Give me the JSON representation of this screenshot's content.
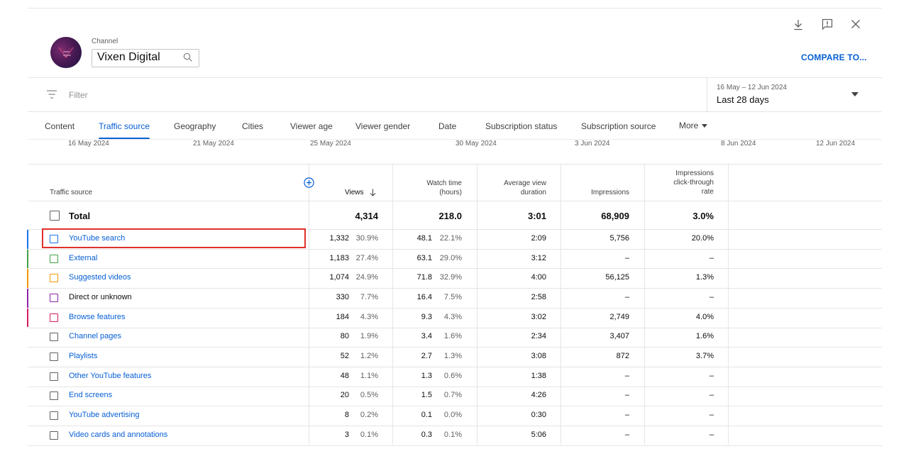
{
  "header": {
    "channel_label": "Channel",
    "channel_name": "Vixen Digital",
    "avatar_text": "vixen digital",
    "compare_label": "COMPARE TO...",
    "icons": [
      "download-icon",
      "feedback-icon",
      "close-icon",
      "search-icon"
    ]
  },
  "filter": {
    "placeholder": "Filter",
    "date_range": "16 May – 12 Jun 2024",
    "period": "Last 28 days"
  },
  "tabs": [
    {
      "label": "Content"
    },
    {
      "label": "Traffic source",
      "active": true
    },
    {
      "label": "Geography"
    },
    {
      "label": "Cities"
    },
    {
      "label": "Viewer age"
    },
    {
      "label": "Viewer gender"
    },
    {
      "label": "Date"
    },
    {
      "label": "Subscription status"
    },
    {
      "label": "Subscription source"
    },
    {
      "label": "More"
    }
  ],
  "date_ticks": [
    "16 May 2024",
    "21 May 2024",
    "25 May 2024",
    "30 May 2024",
    "3 Jun 2024",
    "8 Jun 2024",
    "12 Jun 2024"
  ],
  "table": {
    "columns": {
      "source": "Traffic source",
      "views": "Views",
      "watch_time": [
        "Watch time",
        "(hours)"
      ],
      "avg_view": [
        "Average view",
        "duration"
      ],
      "impressions": "Impressions",
      "ctr": [
        "Impressions",
        "click-through",
        "rate"
      ]
    },
    "total": {
      "label": "Total",
      "views": "4,314",
      "watch": "218.0",
      "avg": "3:01",
      "impressions": "68,909",
      "ctr": "3.0%"
    },
    "rows": [
      {
        "name": "YouTube search",
        "link": true,
        "color": "#1a73e8",
        "views": "1,332",
        "views_pct": "30.9%",
        "watch": "48.1",
        "watch_pct": "22.1%",
        "avg": "2:09",
        "impressions": "5,756",
        "ctr": "20.0%"
      },
      {
        "name": "External",
        "link": true,
        "color": "#43a047",
        "views": "1,183",
        "views_pct": "27.4%",
        "watch": "63.1",
        "watch_pct": "29.0%",
        "avg": "3:12",
        "impressions": "–",
        "ctr": "–"
      },
      {
        "name": "Suggested videos",
        "link": true,
        "color": "#f29900",
        "views": "1,074",
        "views_pct": "24.9%",
        "watch": "71.8",
        "watch_pct": "32.9%",
        "avg": "4:00",
        "impressions": "56,125",
        "ctr": "1.3%"
      },
      {
        "name": "Direct or unknown",
        "link": false,
        "color": "#8e24aa",
        "views": "330",
        "views_pct": "7.7%",
        "watch": "16.4",
        "watch_pct": "7.5%",
        "avg": "2:58",
        "impressions": "–",
        "ctr": "–"
      },
      {
        "name": "Browse features",
        "link": true,
        "color": "#d81b60",
        "views": "184",
        "views_pct": "4.3%",
        "watch": "9.3",
        "watch_pct": "4.3%",
        "avg": "3:02",
        "impressions": "2,749",
        "ctr": "4.0%"
      },
      {
        "name": "Channel pages",
        "link": true,
        "color": "",
        "views": "80",
        "views_pct": "1.9%",
        "watch": "3.4",
        "watch_pct": "1.6%",
        "avg": "2:34",
        "impressions": "3,407",
        "ctr": "1.6%"
      },
      {
        "name": "Playlists",
        "link": true,
        "color": "",
        "views": "52",
        "views_pct": "1.2%",
        "watch": "2.7",
        "watch_pct": "1.3%",
        "avg": "3:08",
        "impressions": "872",
        "ctr": "3.7%"
      },
      {
        "name": "Other YouTube features",
        "link": true,
        "color": "",
        "views": "48",
        "views_pct": "1.1%",
        "watch": "1.3",
        "watch_pct": "0.6%",
        "avg": "1:38",
        "impressions": "–",
        "ctr": "–"
      },
      {
        "name": "End screens",
        "link": true,
        "color": "",
        "views": "20",
        "views_pct": "0.5%",
        "watch": "1.5",
        "watch_pct": "0.7%",
        "avg": "4:26",
        "impressions": "–",
        "ctr": "–"
      },
      {
        "name": "YouTube advertising",
        "link": true,
        "color": "",
        "views": "8",
        "views_pct": "0.2%",
        "watch": "0.1",
        "watch_pct": "0.0%",
        "avg": "0:30",
        "impressions": "–",
        "ctr": "–"
      },
      {
        "name": "Video cards and annotations",
        "link": true,
        "color": "",
        "views": "3",
        "views_pct": "0.1%",
        "watch": "0.3",
        "watch_pct": "0.1%",
        "avg": "5:06",
        "impressions": "–",
        "ctr": "–"
      }
    ]
  }
}
